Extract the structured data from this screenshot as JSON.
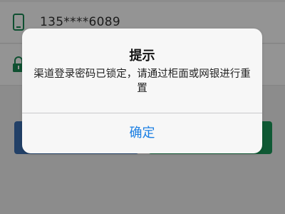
{
  "form": {
    "phone_value": "135****6089",
    "phone_icon": "phone-icon",
    "password_icon": "lock-icon"
  },
  "alert": {
    "title": "提示",
    "message": "渠道登录密码已锁定，请通过柜面或网银进行重置",
    "confirm_label": "确定"
  },
  "colors": {
    "accent": "#1b7fe3",
    "icon": "#1a8a55",
    "button_left": "#3b6fb1",
    "button_right": "#1a9a5a"
  }
}
